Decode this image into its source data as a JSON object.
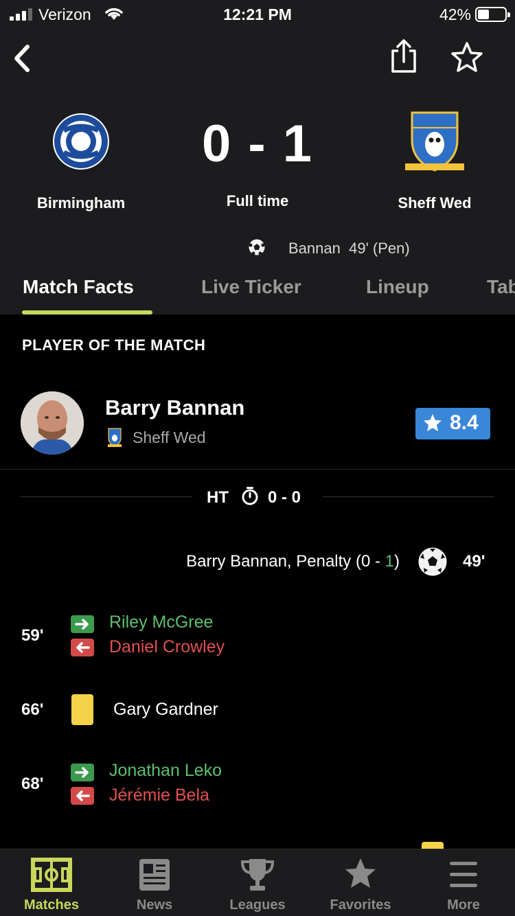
{
  "status_bar": {
    "carrier": "Verizon",
    "time": "12:21 PM",
    "battery": "42%"
  },
  "nav": {
    "back_icon": "chevron-left-icon",
    "share_icon": "share-icon",
    "favorite_icon": "star-outline-icon"
  },
  "match": {
    "home_team": "Birmingham",
    "away_team": "Sheff Wed",
    "score": "0 - 1",
    "status": "Full time",
    "goal_scorer": "Bannan",
    "goal_detail": "49' (Pen)"
  },
  "tabs": [
    "Match Facts",
    "Live Ticker",
    "Lineup",
    "Table"
  ],
  "active_tab": "Match Facts",
  "player_of_match": {
    "section_title": "PLAYER OF THE MATCH",
    "name": "Barry Bannan",
    "team": "Sheff Wed",
    "rating": "8.4"
  },
  "half_time": {
    "label": "HT",
    "score": "0 - 0"
  },
  "events": {
    "goal": {
      "text_prefix": "Barry Bannan, Penalty (0 - ",
      "text_highlight": "1",
      "text_suffix": ")",
      "minute": "49'"
    },
    "sub1": {
      "minute": "59'",
      "in": "Riley McGree",
      "out": "Daniel Crowley"
    },
    "card1": {
      "minute": "66'",
      "player": "Gary Gardner",
      "type": "yellow"
    },
    "sub2": {
      "minute": "68'",
      "in": "Jonathan Leko",
      "out": "Jérémie Bela"
    }
  },
  "tabbar": [
    {
      "label": "Matches",
      "icon": "pitch-icon",
      "active": true
    },
    {
      "label": "News",
      "icon": "newspaper-icon",
      "active": false
    },
    {
      "label": "Leagues",
      "icon": "trophy-icon",
      "active": false
    },
    {
      "label": "Favorites",
      "icon": "star-icon",
      "active": false
    },
    {
      "label": "More",
      "icon": "menu-icon",
      "active": false
    }
  ],
  "colors": {
    "accent": "#c8d85a",
    "rating_bg": "#3a86d9",
    "sub_in": "#3b9a4d",
    "sub_out": "#d44a4a",
    "yellow_card": "#f6d24a"
  }
}
